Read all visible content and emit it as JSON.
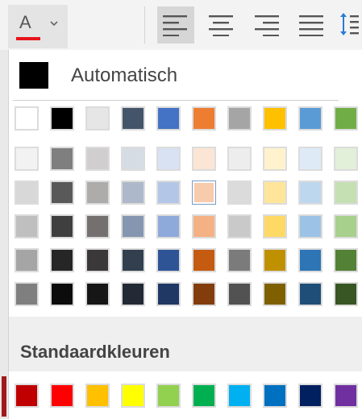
{
  "toolbar": {
    "font_color_letter": "A",
    "font_color_underline": "#e8131b",
    "icons": [
      "font-color-icon",
      "chevron-down-icon",
      "align-left-icon",
      "align-center-icon",
      "align-right-icon",
      "justify-icon",
      "line-spacing-icon"
    ]
  },
  "panel": {
    "automatic_label": "Automatisch",
    "standard_label": "Standaardkleuren"
  },
  "theme_top": [
    "#ffffff",
    "#000000",
    "#e7e6e6",
    "#44546a",
    "#4472c4",
    "#ed7d31",
    "#a5a5a5",
    "#ffc000",
    "#5b9bd5",
    "#70ad47"
  ],
  "theme_shades": [
    [
      "#f2f2f2",
      "#7f7f7f",
      "#d0cece",
      "#d6dce4",
      "#d9e2f3",
      "#fbe5d5",
      "#ededed",
      "#fff2cc",
      "#deebf6",
      "#e2efd9"
    ],
    [
      "#d8d8d8",
      "#595959",
      "#aeabab",
      "#adb9ca",
      "#b4c6e7",
      "#f7cbac",
      "#dbdbdb",
      "#fee599",
      "#bdd7ee",
      "#c5e0b3"
    ],
    [
      "#bfbfbf",
      "#3f3f3f",
      "#757070",
      "#8496b0",
      "#8eaadb",
      "#f4b183",
      "#c9c9c9",
      "#ffd965",
      "#9cc3e5",
      "#a8d08d"
    ],
    [
      "#a5a5a5",
      "#262626",
      "#3a3838",
      "#323f4f",
      "#2f5496",
      "#c55a11",
      "#7b7b7b",
      "#bf9000",
      "#2e75b5",
      "#538135"
    ],
    [
      "#7f7f7f",
      "#0c0c0c",
      "#171616",
      "#222a35",
      "#1f3864",
      "#833c0b",
      "#525252",
      "#7f6000",
      "#1f4e79",
      "#375623"
    ]
  ],
  "selected_swatch": {
    "row": 1,
    "col": 5
  },
  "standard_colors": [
    "#c00000",
    "#ff0000",
    "#ffc000",
    "#ffff00",
    "#92d050",
    "#00b050",
    "#00b0f0",
    "#0070c0",
    "#002060",
    "#7030a0"
  ]
}
